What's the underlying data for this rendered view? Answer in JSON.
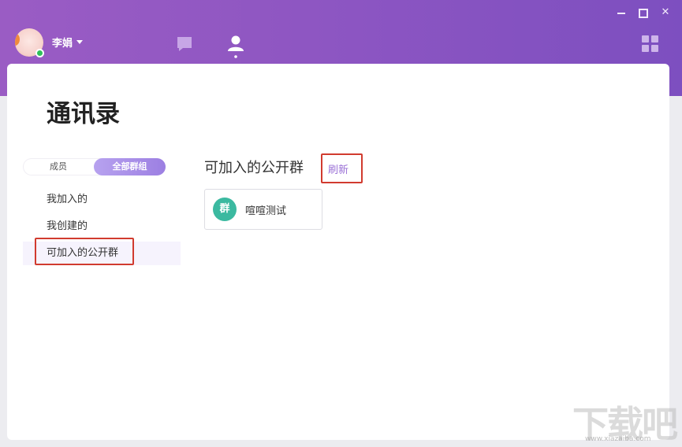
{
  "window": {
    "minimize_icon": "minimize-icon",
    "maximize_icon": "maximize-icon",
    "close_icon": "close-icon",
    "close_glyph": "✕"
  },
  "header": {
    "username": "李娟",
    "presence": "online",
    "nav": [
      {
        "name": "chat",
        "icon": "chat-bubble-icon"
      },
      {
        "name": "contacts",
        "icon": "person-icon",
        "active": true
      }
    ],
    "apps_icon": "grid-apps-icon"
  },
  "page": {
    "title": "通讯录"
  },
  "toggle": {
    "members_label": "成员",
    "groups_label": "全部群组",
    "selected": "全部群组"
  },
  "sidebar": {
    "items": [
      {
        "label": "我加入的"
      },
      {
        "label": "我创建的"
      },
      {
        "label": "可加入的公开群"
      }
    ]
  },
  "content": {
    "section_title": "可加入的公开群",
    "refresh_label": "刷新",
    "groups": [
      {
        "avatar_text": "群",
        "name": "喧喧测试",
        "avatar_color": "#3bb9a0"
      }
    ]
  },
  "watermark": {
    "logo_text": "下载吧",
    "url": "www.xiazaiba.com"
  },
  "colors": {
    "header_purple": "#8e56c2",
    "accent": "#9a70d6",
    "highlight_box": "#d13b2f",
    "online": "#2fc05a"
  }
}
